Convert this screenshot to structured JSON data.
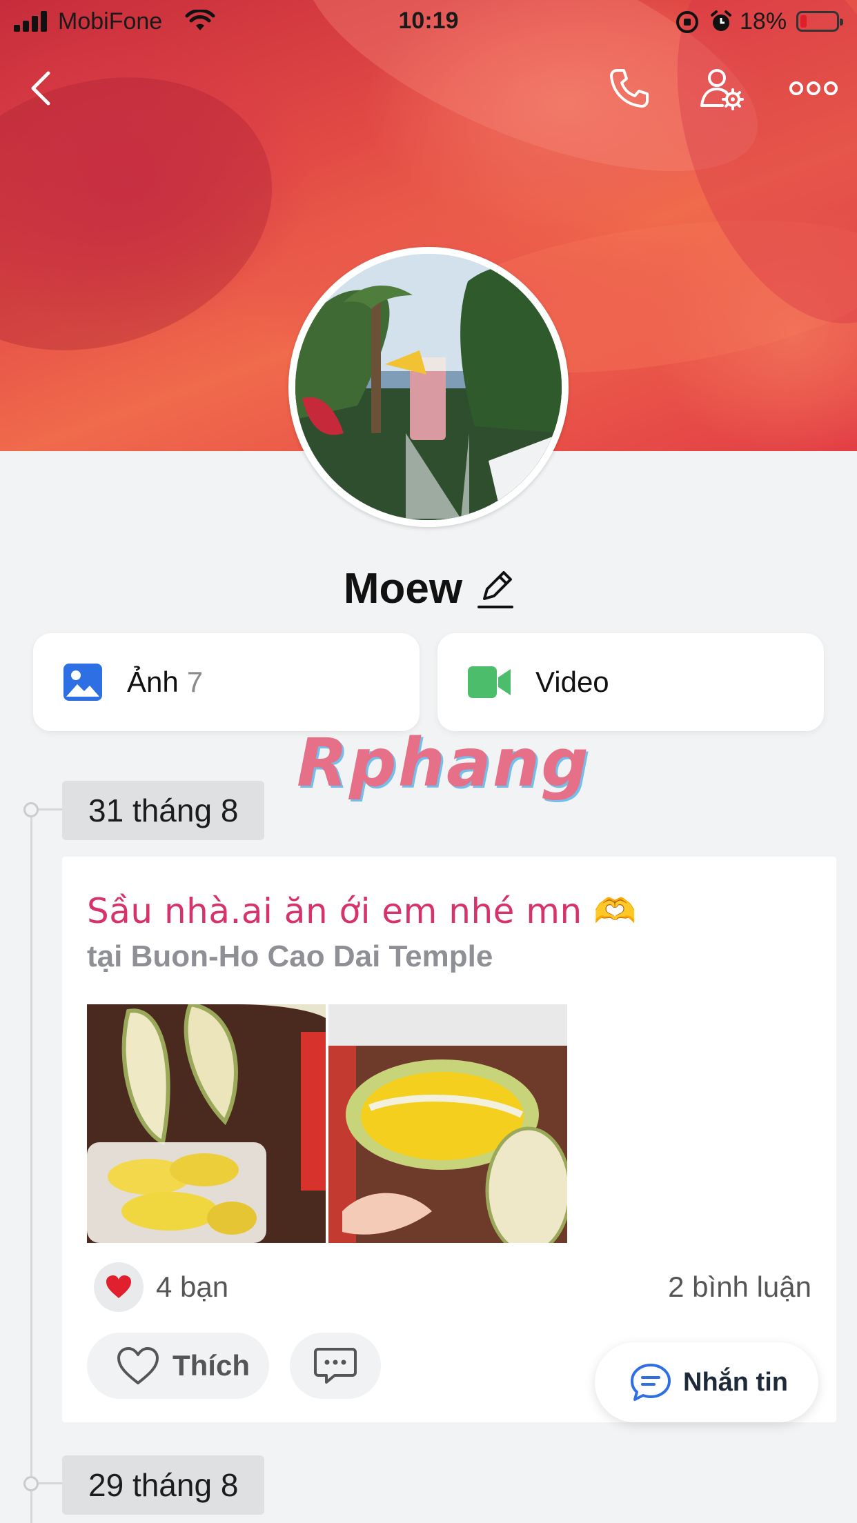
{
  "status_bar": {
    "carrier": "MobiFone",
    "time": "10:19",
    "battery_pct": "18%",
    "battery_level": 0.18,
    "icons": [
      "signal-icon",
      "wifi-icon",
      "orientation-lock-icon",
      "alarm-icon",
      "battery-icon"
    ]
  },
  "nav": {
    "icons": [
      "back-icon",
      "phone-icon",
      "user-settings-icon",
      "more-icon"
    ]
  },
  "profile": {
    "name": "Moew",
    "edit_icon": "pencil-icon"
  },
  "media": {
    "photos_label": "Ảnh",
    "photos_count": "7",
    "photos_icon": "image-icon",
    "video_label": "Video",
    "video_icon": "video-camera-icon"
  },
  "watermark": "Rphang",
  "timeline": {
    "dates": [
      "31 tháng 8",
      "29 tháng 8"
    ]
  },
  "post": {
    "title": "Sầu nhà.ai ăn ới em nhé mn 🫶",
    "location": "tại Buon-Ho Cao Dai Temple",
    "reaction_icon": "heart-icon",
    "reaction_count": "4 bạn",
    "comment_count": "2 bình luận",
    "like_label": "Thích",
    "comment_icon": "comment-icon"
  },
  "message_button": {
    "label": "Nhắn tin",
    "icon": "chat-bubble-icon"
  },
  "colors": {
    "accent_pink": "#d6336c",
    "photo_icon_blue": "#2f6fe4",
    "video_icon_green": "#4cbe6b",
    "battery_low_red": "#e01e2a",
    "heart_red": "#e0202e"
  }
}
